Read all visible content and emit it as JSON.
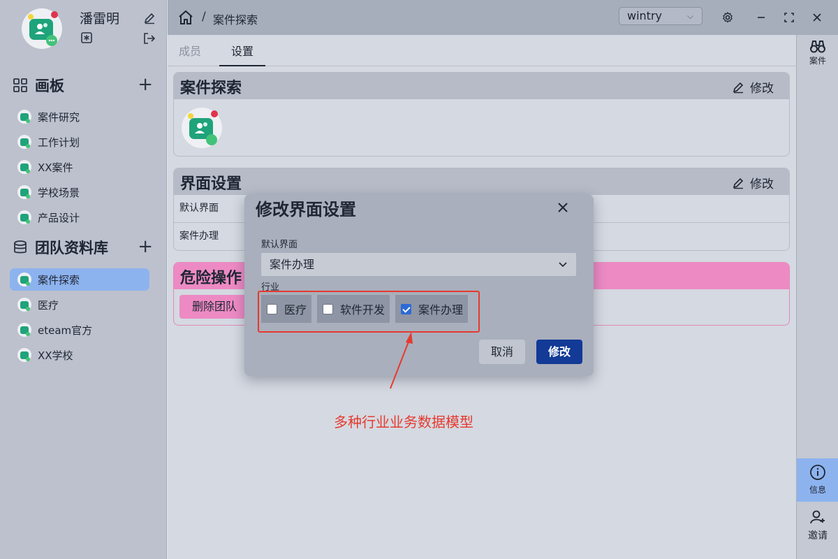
{
  "user": {
    "name": "潘雷明"
  },
  "sidebar": {
    "boards_title": "画板",
    "boards": [
      "案件研究",
      "工作计划",
      "XX案件",
      "学校场景",
      "产品设计"
    ],
    "library_title": "团队资料库",
    "teams": [
      "案件探索",
      "医疗",
      "eteam官方",
      "XX学校"
    ],
    "active_team_index": 0
  },
  "topbar": {
    "breadcrumb_sep": "/",
    "breadcrumb": "案件探索",
    "workspace": "wintry"
  },
  "tabs": [
    "成员",
    "设置"
  ],
  "active_tab": "设置",
  "cards": {
    "team_title": "案件探索",
    "edit_label": "修改",
    "ui_title": "界面设置",
    "ui_rows": [
      "默认界面",
      "案件办理"
    ],
    "danger_title": "危险操作",
    "delete_label": "删除团队"
  },
  "modal": {
    "title": "修改界面设置",
    "default_label": "默认界面",
    "default_value": "案件办理",
    "industry_label": "行业",
    "options": [
      {
        "label": "医疗",
        "checked": false
      },
      {
        "label": "软件开发",
        "checked": false
      },
      {
        "label": "案件办理",
        "checked": true
      }
    ],
    "cancel": "取消",
    "submit": "修改"
  },
  "rail": {
    "case": "案件",
    "info": "信息",
    "invite": "邀请"
  },
  "annotation": "多种行业业务数据模型",
  "colors": {
    "accent": "#123a96",
    "active_nav": "#8db3ef",
    "danger": "#ed8ac4",
    "annotation": "#e53a2f"
  }
}
